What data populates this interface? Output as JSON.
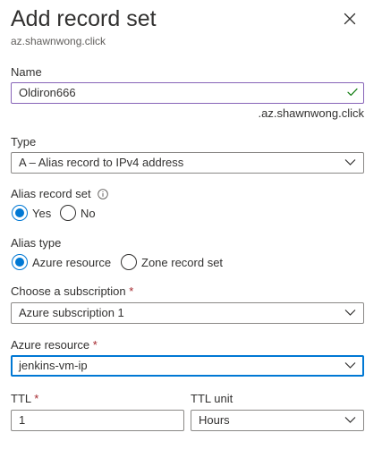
{
  "panel": {
    "title": "Add record set",
    "subtitle": "az.shawnwong.click"
  },
  "icons": {
    "close": "close-icon",
    "check": "check-icon",
    "chevron": "chevron-down-icon",
    "info": "info-icon"
  },
  "colors": {
    "accent": "#0078d4",
    "valid_check": "#107c10",
    "name_border": "#8764b8",
    "required": "#a4262c"
  },
  "form": {
    "name": {
      "label": "Name",
      "value": "Oldiron666",
      "suffix": ".az.shawnwong.click",
      "valid": true
    },
    "type": {
      "label": "Type",
      "value": "A – Alias record to IPv4 address"
    },
    "alias_record_set": {
      "label": "Alias record set",
      "options": [
        "Yes",
        "No"
      ],
      "selected": "Yes"
    },
    "alias_type": {
      "label": "Alias type",
      "options": [
        "Azure resource",
        "Zone record set"
      ],
      "selected": "Azure resource"
    },
    "subscription": {
      "label": "Choose a subscription",
      "required_marker": "*",
      "value": "Azure subscription 1"
    },
    "azure_resource": {
      "label": "Azure resource",
      "required_marker": "*",
      "value": "jenkins-vm-ip"
    },
    "ttl": {
      "label": "TTL",
      "required_marker": "*",
      "value": "1"
    },
    "ttl_unit": {
      "label": "TTL unit",
      "value": "Hours"
    }
  }
}
